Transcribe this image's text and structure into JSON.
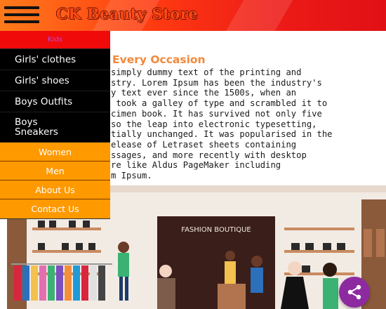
{
  "header": {
    "title": "CK Beauty Store",
    "menu_icon": "hamburger-menu-icon",
    "gradient_colors": [
      "#ff7a1a",
      "#ee1c17"
    ]
  },
  "sidebar": {
    "kids": "Kids",
    "items": [
      {
        "label": "Girls' clothes"
      },
      {
        "label": "Girls' shoes"
      },
      {
        "label": "Boys Outfits"
      },
      {
        "label": "Boys\nSneakers"
      }
    ],
    "categories": [
      {
        "label": "Women"
      },
      {
        "label": "Men"
      },
      {
        "label": "About Us"
      },
      {
        "label": "Contact Us"
      }
    ],
    "colors": {
      "kids_bg": "#f00a0a",
      "dark_bg": "#000000",
      "orange_bg": "#ff9900"
    }
  },
  "article": {
    "title": "Every Occasion",
    "lines": [
      "simply dummy text of the printing and",
      "stry. Lorem Ipsum has been the industry's",
      "y text ever since the 1500s, when an",
      " took a galley of type and scrambled it to",
      "cimen book. It has survived not only five",
      "so the leap into electronic typesetting,",
      "tially unchanged. It was popularised in the",
      "elease of Letraset sheets containing",
      "ssages, and more recently with desktop",
      "re like Aldus PageMaker including",
      "m Ipsum."
    ],
    "title_color": "#f2883a"
  },
  "scene": {
    "sign": "FASHION BOUTIQUE"
  },
  "share": {
    "icon": "share-icon",
    "color": "#8d2aa0"
  }
}
